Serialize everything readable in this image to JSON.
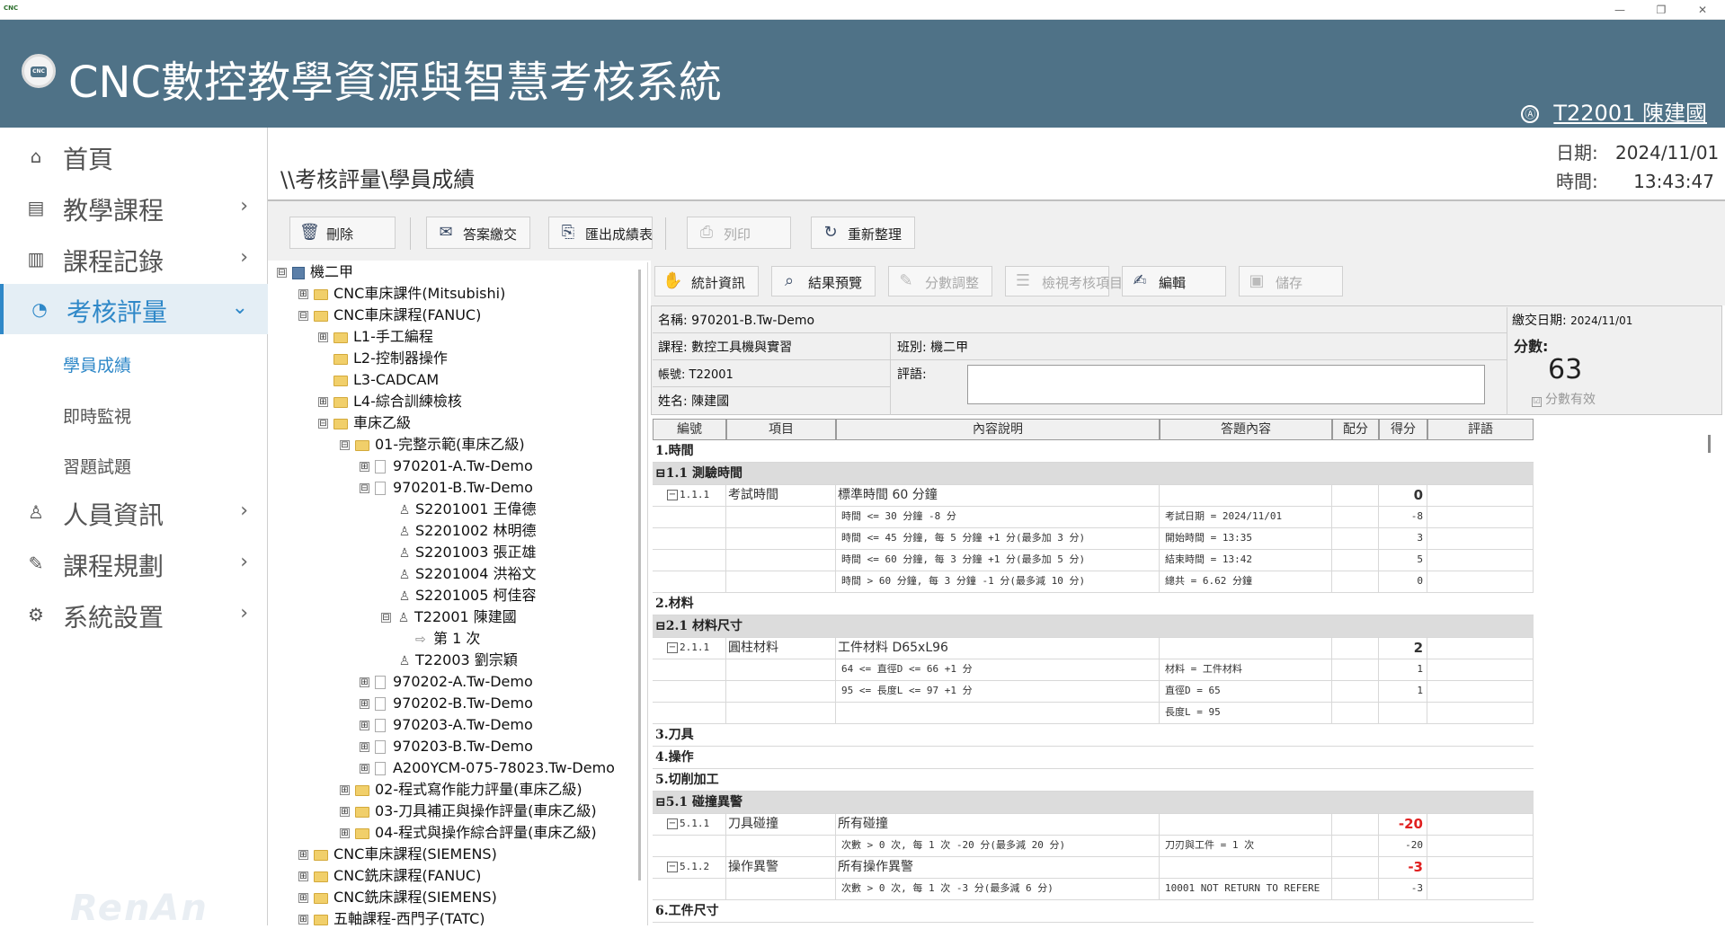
{
  "window": {
    "minimize": "—",
    "restore": "❐",
    "close": "✕",
    "app_icon_text": "CNC"
  },
  "header": {
    "logo_text": "CNC",
    "title": "CNC數控教學資源與智慧考核系統",
    "user_icon": "Ⓐ",
    "user": "T22001 陳建國"
  },
  "sidebar": {
    "items": [
      {
        "label": "首頁",
        "icon": "⌂"
      },
      {
        "label": "教學課程",
        "icon": "▤"
      },
      {
        "label": "課程記錄",
        "icon": "▥"
      },
      {
        "label": "考核評量",
        "icon": "◔"
      },
      {
        "label": "人員資訊",
        "icon": "♙"
      },
      {
        "label": "課程規劃",
        "icon": "✎"
      },
      {
        "label": "系統設置",
        "icon": "⚙"
      }
    ],
    "chevron": "›",
    "chevron_open": "⌄",
    "subitems": [
      "學員成績",
      "即時監視",
      "習題試題"
    ],
    "watermark": "RenAn"
  },
  "main": {
    "breadcrumb": "\\\\考核評量\\學員成績",
    "date_label": "日期:",
    "date_value": "2024/11/01",
    "time_label": "時間:",
    "time_value": "13:43:47"
  },
  "toolbar": {
    "delete": "刪除",
    "submit": "答案繳交",
    "export": "匯出成績表",
    "print": "列印",
    "refresh": "重新整理"
  },
  "tree": {
    "nodes": [
      {
        "text": "機二甲",
        "exp": "⊟",
        "kind": "root",
        "lvl": 0
      },
      {
        "text": "CNC車床課件(Mitsubishi)",
        "exp": "⊞",
        "kind": "folder",
        "lvl": 1
      },
      {
        "text": "CNC車床課程(FANUC)",
        "exp": "⊟",
        "kind": "folder",
        "lvl": 1
      },
      {
        "text": "L1-手工編程",
        "exp": "⊞",
        "kind": "folder",
        "lvl": 2
      },
      {
        "text": "L2-控制器操作",
        "exp": "",
        "kind": "folder",
        "lvl": 2
      },
      {
        "text": "L3-CADCAM",
        "exp": "",
        "kind": "folder",
        "lvl": 2
      },
      {
        "text": "L4-綜合訓練檢核",
        "exp": "⊞",
        "kind": "folder",
        "lvl": 2
      },
      {
        "text": "車床乙級",
        "exp": "⊟",
        "kind": "folder",
        "lvl": 2
      },
      {
        "text": "01-完整示範(車床乙級)",
        "exp": "⊟",
        "kind": "folder",
        "lvl": 3
      },
      {
        "text": "970201-A.Tw-Demo",
        "exp": "⊞",
        "kind": "doc",
        "lvl": 4
      },
      {
        "text": "970201-B.Tw-Demo",
        "exp": "⊟",
        "kind": "doc",
        "lvl": 4
      },
      {
        "text": "S2201001 王偉德",
        "exp": "",
        "kind": "person",
        "lvl": 5
      },
      {
        "text": "S2201002 林明德",
        "exp": "",
        "kind": "person",
        "lvl": 5
      },
      {
        "text": "S2201003 張正雄",
        "exp": "",
        "kind": "person",
        "lvl": 5
      },
      {
        "text": "S2201004 洪裕文",
        "exp": "",
        "kind": "person",
        "lvl": 5
      },
      {
        "text": "S2201005 柯佳容",
        "exp": "",
        "kind": "person",
        "lvl": 5
      },
      {
        "text": "T22001 陳建國",
        "exp": "⊟",
        "kind": "person",
        "lvl": 5
      },
      {
        "text": "第 1 次",
        "exp": "",
        "kind": "arrow",
        "lvl": 6
      },
      {
        "text": "T22003 劉宗穎",
        "exp": "",
        "kind": "person",
        "lvl": 5
      },
      {
        "text": "970202-A.Tw-Demo",
        "exp": "⊞",
        "kind": "doc",
        "lvl": 4
      },
      {
        "text": "970202-B.Tw-Demo",
        "exp": "⊞",
        "kind": "doc",
        "lvl": 4
      },
      {
        "text": "970203-A.Tw-Demo",
        "exp": "⊞",
        "kind": "doc",
        "lvl": 4
      },
      {
        "text": "970203-B.Tw-Demo",
        "exp": "⊞",
        "kind": "doc",
        "lvl": 4
      },
      {
        "text": "A200YCM-075-78023.Tw-Demo",
        "exp": "⊞",
        "kind": "doc",
        "lvl": 4
      },
      {
        "text": "02-程式寫作能力評量(車床乙級)",
        "exp": "⊞",
        "kind": "folder",
        "lvl": 3
      },
      {
        "text": "03-刀具補正與操作評量(車床乙級)",
        "exp": "⊞",
        "kind": "folder",
        "lvl": 3
      },
      {
        "text": "04-程式與操作綜合評量(車床乙級)",
        "exp": "⊞",
        "kind": "folder",
        "lvl": 3
      },
      {
        "text": "CNC車床課程(SIEMENS)",
        "exp": "⊞",
        "kind": "folder",
        "lvl": 1
      },
      {
        "text": "CNC銑床課程(FANUC)",
        "exp": "⊞",
        "kind": "folder",
        "lvl": 1
      },
      {
        "text": "CNC銑床課程(SIEMENS)",
        "exp": "⊞",
        "kind": "folder",
        "lvl": 1
      },
      {
        "text": "五軸課程-西門子(TATC)",
        "exp": "⊞",
        "kind": "folder",
        "lvl": 1
      }
    ]
  },
  "panel": {
    "stats": "統計資訊",
    "preview": "結果預覽",
    "adjust": "分數調整",
    "review": "檢視考核項目",
    "edit": "編輯",
    "save": "儲存"
  },
  "info": {
    "name": "名稱: 970201-B.Tw-Demo",
    "submit_date_label": "繳交日期:",
    "submit_date": "2024/11/01",
    "course": "課程: 數控工具機與實習",
    "class": "班別: 機二甲",
    "account": "帳號: T22001",
    "comment_label": "評語:",
    "student": "姓名: 陳建國",
    "score_label": "分數:",
    "score": "63",
    "score_valid_check": "☑",
    "score_valid": "分數有效"
  },
  "grid": {
    "headers": [
      "編號",
      "項目",
      "內容說明",
      "答題內容",
      "配分",
      "得分",
      "評語"
    ],
    "rows": [
      {
        "type": "sect",
        "label": "1.時間"
      },
      {
        "type": "group",
        "label": "⊟1.1  測驗時間"
      },
      {
        "type": "item",
        "no": "1.1.1",
        "item": "考試時間",
        "desc": "標準時間 60 分鐘",
        "ans": "",
        "score": "0",
        "neg": false
      },
      {
        "type": "detail",
        "desc": "時間 <= 30 分鐘 -8 分",
        "ans": "考試日期 = 2024/11/01",
        "score": "-8"
      },
      {
        "type": "detail",
        "desc": "時間 <= 45 分鐘, 每 5 分鐘 +1 分(最多加 3 分)",
        "ans": "開始時間 = 13:35",
        "score": "3"
      },
      {
        "type": "detail",
        "desc": "時間 <= 60 分鐘, 每 3 分鐘 +1 分(最多加 5 分)",
        "ans": "結束時間 = 13:42",
        "score": "5"
      },
      {
        "type": "detail",
        "desc": "時間 > 60 分鐘, 每 3 分鐘 -1 分(最多減 10 分)",
        "ans": "總共 = 6.62 分鐘",
        "score": "0"
      },
      {
        "type": "sect",
        "label": "2.材料"
      },
      {
        "type": "group",
        "label": "⊟2.1  材料尺寸"
      },
      {
        "type": "item",
        "no": "2.1.1",
        "item": "圓柱材料",
        "desc": "工件材料 D65xL96",
        "ans": "",
        "score": "2",
        "neg": false
      },
      {
        "type": "detail",
        "desc": "64 <= 直徑D <= 66 +1 分",
        "ans": "材料 = 工件材料",
        "score": "1"
      },
      {
        "type": "detail",
        "desc": "95 <= 長度L <= 97 +1 分",
        "ans": "直徑D = 65",
        "score": "1"
      },
      {
        "type": "detail",
        "desc": "",
        "ans": "長度L = 95",
        "score": ""
      },
      {
        "type": "sect",
        "label": "3.刀具"
      },
      {
        "type": "sect",
        "label": "4.操作"
      },
      {
        "type": "sect",
        "label": "5.切削加工"
      },
      {
        "type": "group",
        "label": "⊟5.1  碰撞異警"
      },
      {
        "type": "item",
        "no": "5.1.1",
        "item": "刀具碰撞",
        "desc": "所有碰撞",
        "ans": "",
        "score": "-20",
        "neg": true
      },
      {
        "type": "detail",
        "desc": "次數 > 0 次, 每 1 次 -20 分(最多減 20 分)",
        "ans": "刀刃與工件 = 1 次",
        "score": "-20"
      },
      {
        "type": "item",
        "no": "5.1.2",
        "item": "操作異警",
        "desc": "所有操作異警",
        "ans": "",
        "score": "-3",
        "neg": true
      },
      {
        "type": "detail",
        "desc": "次數 > 0 次, 每 1 次 -3 分(最多減 6 分)",
        "ans": "10001 NOT RETURN TO REFERE",
        "score": "-3"
      },
      {
        "type": "sect",
        "label": "6.工件尺寸"
      }
    ]
  }
}
